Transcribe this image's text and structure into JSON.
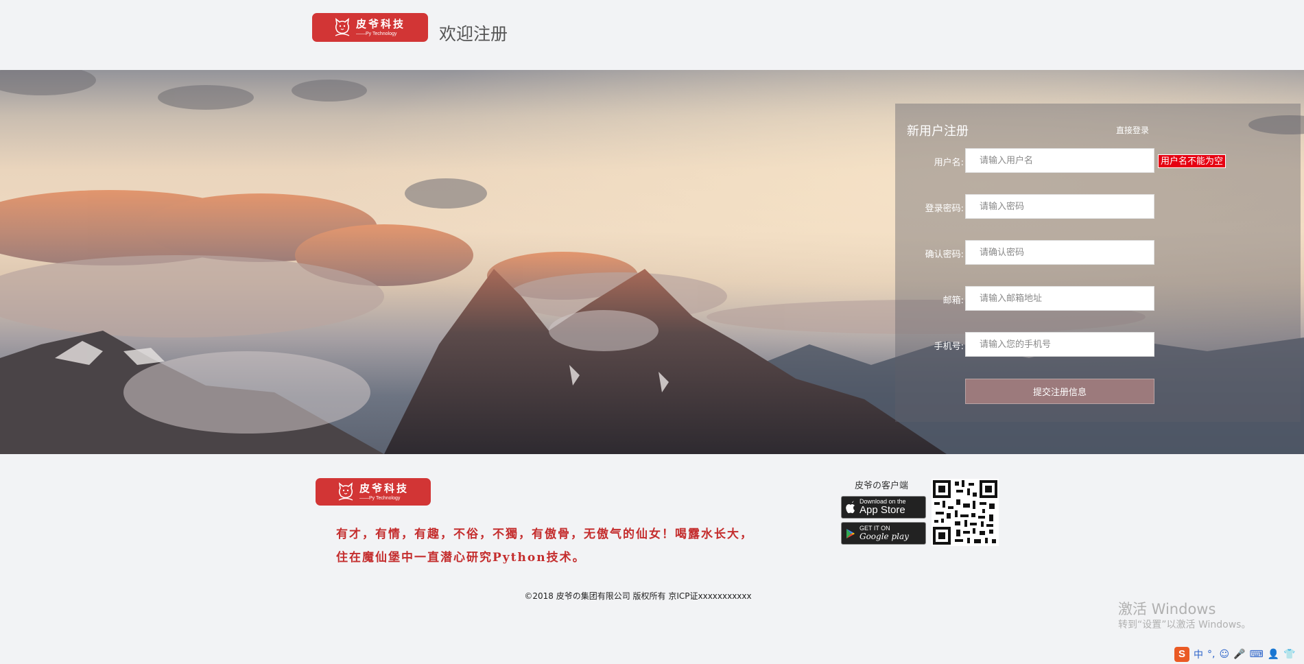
{
  "header": {
    "logo": {
      "name": "皮爷科技",
      "sub": "——Py Technology"
    },
    "title": "欢迎注册"
  },
  "form": {
    "title": "新用户注册",
    "login_link": "直接登录",
    "fields": [
      {
        "label": "用户名:",
        "placeholder": "请输入用户名"
      },
      {
        "label": "登录密码:",
        "placeholder": "请输入密码"
      },
      {
        "label": "确认密码:",
        "placeholder": "请确认密码"
      },
      {
        "label": "邮箱:",
        "placeholder": "请输入邮箱地址"
      },
      {
        "label": "手机号:",
        "placeholder": "请输入您的手机号"
      }
    ],
    "error": "用户名不能为空",
    "submit": "提交注册信息"
  },
  "footer": {
    "logo": {
      "name": "皮爷科技",
      "sub": "——Py Technology"
    },
    "slogan_line1": "有才，有情，有趣，不俗，不獨，有傲骨，无傲气的仙女！喝露水长大，",
    "slogan_line2": "住在魔仙堡中一直潜心研究Python技术。",
    "client_label": "皮爷の客户端",
    "app_store": {
      "small": "Download on the",
      "big": "App Store"
    },
    "google_play": {
      "small": "GET IT ON",
      "big": "Google play"
    },
    "copyright": "©2018 皮爷の集团有限公司 版权所有 京ICP证xxxxxxxxxxx"
  },
  "watermark": {
    "title": "激活 Windows",
    "subtitle": "转到“设置”以激活 Windows。"
  },
  "ime": {
    "logo": "S",
    "items": [
      "中",
      "°,",
      "☺",
      "🎤",
      "⌨",
      "👤",
      "👕"
    ]
  },
  "colors": {
    "brand": "#d23535",
    "error": "#e60012",
    "submit": "#9c7a7c"
  }
}
